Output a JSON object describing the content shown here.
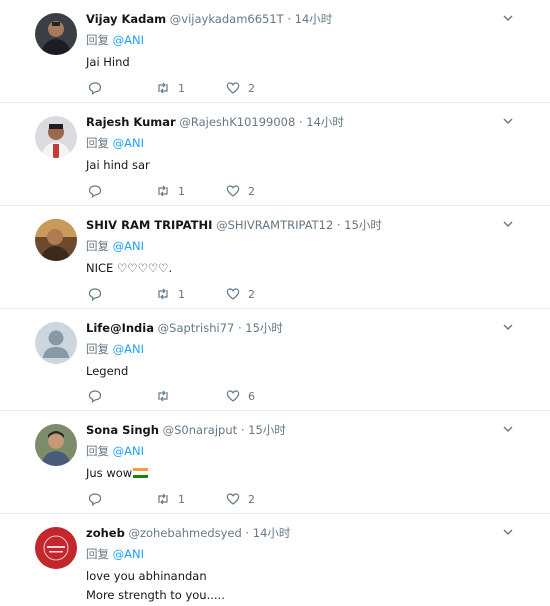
{
  "reply_label": "回复",
  "tweets": [
    {
      "name": "Vijay Kadam",
      "handle": "@vijaykadam6651T",
      "time": "14小时",
      "mention": "@ANI",
      "text": "Jai Hind",
      "retweets": "1",
      "likes": "2",
      "avatar": "photo-dark-jacket"
    },
    {
      "name": "Rajesh Kumar",
      "handle": "@RajeshK10199008",
      "time": "14小时",
      "mention": "@ANI",
      "text": "Jai hind sar",
      "retweets": "1",
      "likes": "2",
      "avatar": "photo-white-shirt"
    },
    {
      "name": "SHIV RAM TRIPATHI",
      "handle": "@SHIVRAMTRIPAT12",
      "time": "15小时",
      "mention": "@ANI",
      "text": "NICE ♡♡♡♡♡.",
      "retweets": "1",
      "likes": "2",
      "avatar": "photo-warm"
    },
    {
      "name": "Life@India",
      "handle": "@Saptrishi77",
      "time": "15小时",
      "mention": "@ANI",
      "text": "Legend",
      "retweets": "",
      "likes": "6",
      "avatar": "default-egg"
    },
    {
      "name": "Sona Singh",
      "handle": "@S0narajput",
      "time": "15小时",
      "mention": "@ANI",
      "text": "Jus wow",
      "retweets": "1",
      "likes": "2",
      "avatar": "photo-portrait",
      "flag": "india-flag"
    },
    {
      "name": "zoheb",
      "handle": "@zohebahmedsyed",
      "time": "14小时",
      "mention": "@ANI",
      "text": "love you abhinandan",
      "text2": "More strength to you.....",
      "avatar": "red-badge"
    }
  ],
  "colors": {
    "accent": "#1da1f2",
    "muted": "#657786",
    "divider": "#e6ecf0"
  }
}
